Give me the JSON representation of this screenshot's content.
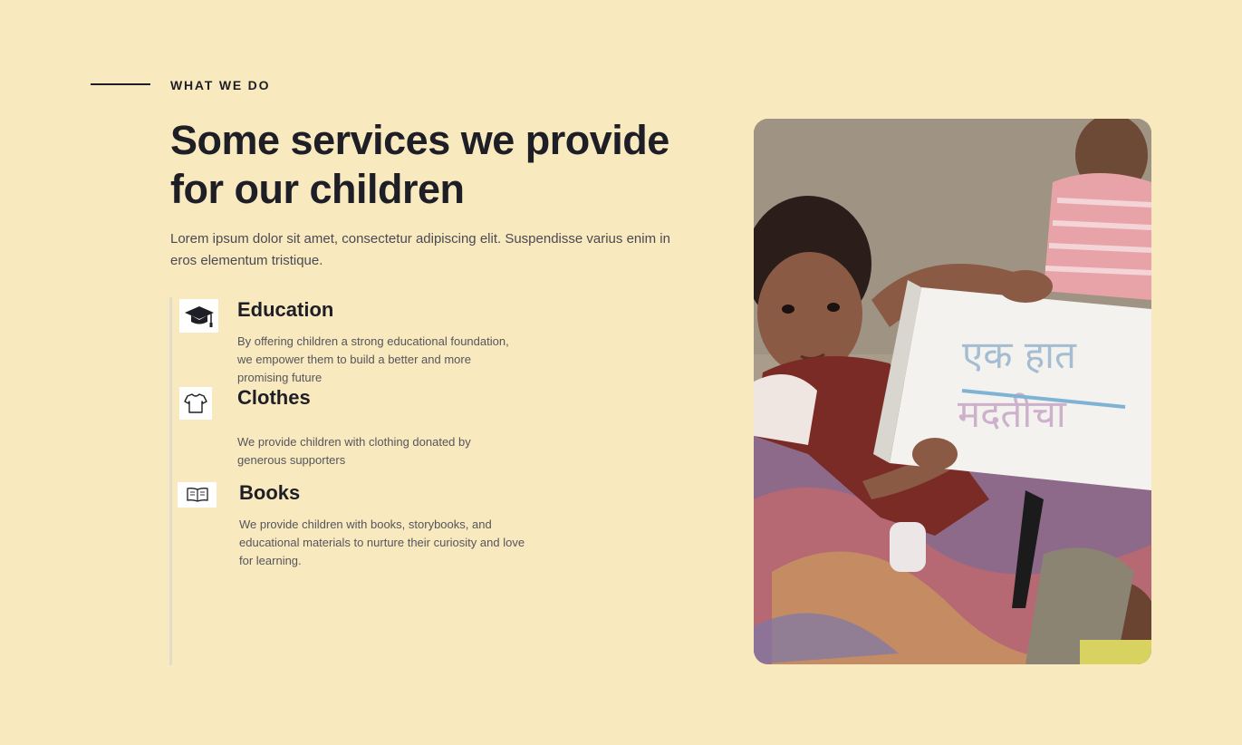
{
  "section": {
    "eyebrow": "WHAT WE DO",
    "heading": "Some services we provide for our children",
    "intro": "Lorem ipsum dolor sit amet, consectetur adipiscing elit. Suspendisse varius enim in eros elementum tristique."
  },
  "services": [
    {
      "icon": "graduation-cap-icon",
      "title": "Education",
      "description": "By offering children a strong educational foundation, we empower them to build a better and more promising future"
    },
    {
      "icon": "tshirt-icon",
      "title": "Clothes",
      "description": "We provide children with clothing donated by generous supporters"
    },
    {
      "icon": "open-book-icon",
      "title": "Books",
      "description": "We provide children with books, storybooks, and educational materials to nurture their curiosity and love for learning."
    }
  ],
  "photo": {
    "sign_text_line1": "एक हात",
    "sign_text_line2": "मदतीचा"
  },
  "colors": {
    "background": "#f9e9bf",
    "text": "#1e1e26",
    "muted_text": "#55555c",
    "rail": "#e4dccb"
  }
}
